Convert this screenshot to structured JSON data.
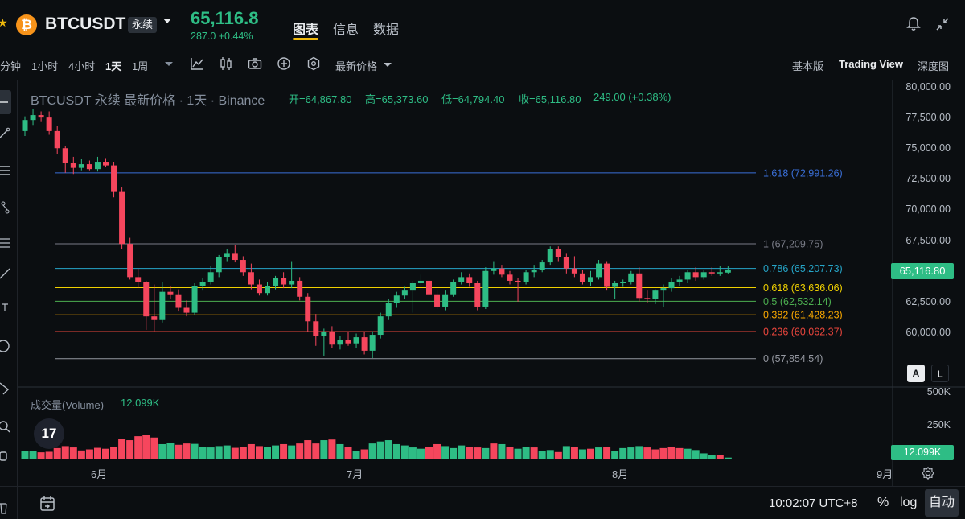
{
  "header": {
    "symbol": "BTCUSDT",
    "contract_badge": "永续",
    "last_price": "65,116.8",
    "change_text": "287.0 +0.44%",
    "tabs": [
      "图表",
      "信息",
      "数据"
    ],
    "active_tab": "图表"
  },
  "toolbar": {
    "timeframes": [
      "分钟",
      "1小时",
      "4小时",
      "1天",
      "1周"
    ],
    "active_timeframe": "1天",
    "price_type": "最新价格",
    "views": [
      "基本版",
      "Trading View",
      "深度图"
    ],
    "active_view": "Trading View"
  },
  "legend": {
    "title": "BTCUSDT 永续 最新价格 · 1天 · Binance",
    "open": "开=64,867.80",
    "high": "高=65,373.60",
    "low": "低=64,794.40",
    "close": "收=65,116.80",
    "change": "249.00 (+0.38%)"
  },
  "volume": {
    "label": "成交量(Volume)",
    "value": "12.099K",
    "axis": [
      "500K",
      "250K"
    ],
    "tag": "12.099K"
  },
  "price_axis": [
    "80,000.00",
    "77,500.00",
    "75,000.00",
    "72,500.00",
    "70,000.00",
    "67,500.00",
    "62,500.00",
    "60,000.00"
  ],
  "price_tag": "65,116.80",
  "scale_buttons": [
    "A",
    "L"
  ],
  "months": [
    "6月",
    "7月",
    "8月",
    "9月"
  ],
  "bottom": {
    "clock": "10:02:07 UTC+8",
    "percent": "%",
    "log": "log",
    "auto": "自动"
  },
  "colors": {
    "up": "#2ebd85",
    "down": "#f6465d",
    "accent": "#f0b90b",
    "background": "#0b0e11"
  },
  "chart_data": {
    "type": "candlestick",
    "interval": "1天",
    "ylim": [
      57000,
      80000
    ],
    "candles": [
      {
        "o": 76400,
        "h": 77600,
        "l": 76000,
        "c": 77300
      },
      {
        "o": 77300,
        "h": 78200,
        "l": 76900,
        "c": 77700
      },
      {
        "o": 77700,
        "h": 78000,
        "l": 77200,
        "c": 77500
      },
      {
        "o": 77500,
        "h": 78000,
        "l": 76100,
        "c": 76400
      },
      {
        "o": 76400,
        "h": 76800,
        "l": 74500,
        "c": 75000
      },
      {
        "o": 75000,
        "h": 75200,
        "l": 73000,
        "c": 73800
      },
      {
        "o": 73800,
        "h": 74300,
        "l": 72900,
        "c": 73400
      },
      {
        "o": 73400,
        "h": 74100,
        "l": 73200,
        "c": 73700
      },
      {
        "o": 73700,
        "h": 74000,
        "l": 73200,
        "c": 73300
      },
      {
        "o": 73300,
        "h": 74300,
        "l": 73100,
        "c": 73900
      },
      {
        "o": 73900,
        "h": 74200,
        "l": 73500,
        "c": 73600
      },
      {
        "o": 73600,
        "h": 73900,
        "l": 71000,
        "c": 71500
      },
      {
        "o": 71500,
        "h": 71800,
        "l": 66800,
        "c": 67200
      },
      {
        "o": 67200,
        "h": 67700,
        "l": 64300,
        "c": 64500
      },
      {
        "o": 64500,
        "h": 65200,
        "l": 63600,
        "c": 64100
      },
      {
        "o": 64100,
        "h": 64200,
        "l": 60200,
        "c": 61300
      },
      {
        "o": 61300,
        "h": 63900,
        "l": 60100,
        "c": 61000
      },
      {
        "o": 61000,
        "h": 64100,
        "l": 60800,
        "c": 63300
      },
      {
        "o": 63300,
        "h": 63800,
        "l": 62700,
        "c": 63100
      },
      {
        "o": 63100,
        "h": 63500,
        "l": 61700,
        "c": 62000
      },
      {
        "o": 62000,
        "h": 62600,
        "l": 61300,
        "c": 61600
      },
      {
        "o": 61600,
        "h": 64000,
        "l": 61400,
        "c": 63800
      },
      {
        "o": 63800,
        "h": 64400,
        "l": 63400,
        "c": 64100
      },
      {
        "o": 64100,
        "h": 65400,
        "l": 63900,
        "c": 64900
      },
      {
        "o": 64900,
        "h": 66300,
        "l": 64500,
        "c": 66100
      },
      {
        "o": 66100,
        "h": 66800,
        "l": 65800,
        "c": 66400
      },
      {
        "o": 66400,
        "h": 67100,
        "l": 65700,
        "c": 65900
      },
      {
        "o": 65900,
        "h": 66200,
        "l": 64600,
        "c": 64900
      },
      {
        "o": 64900,
        "h": 65600,
        "l": 63500,
        "c": 63900
      },
      {
        "o": 63900,
        "h": 64300,
        "l": 63000,
        "c": 63200
      },
      {
        "o": 63200,
        "h": 64100,
        "l": 63000,
        "c": 63800
      },
      {
        "o": 63800,
        "h": 64600,
        "l": 63500,
        "c": 64400
      },
      {
        "o": 64400,
        "h": 64900,
        "l": 63600,
        "c": 63900
      },
      {
        "o": 63900,
        "h": 65800,
        "l": 63600,
        "c": 64200
      },
      {
        "o": 64200,
        "h": 64500,
        "l": 62600,
        "c": 62900
      },
      {
        "o": 62900,
        "h": 63200,
        "l": 60000,
        "c": 60900
      },
      {
        "o": 60900,
        "h": 61500,
        "l": 58900,
        "c": 59700
      },
      {
        "o": 59700,
        "h": 60300,
        "l": 58100,
        "c": 60000
      },
      {
        "o": 60000,
        "h": 60500,
        "l": 58700,
        "c": 59000
      },
      {
        "o": 59000,
        "h": 59700,
        "l": 58600,
        "c": 59400
      },
      {
        "o": 59400,
        "h": 60000,
        "l": 58900,
        "c": 59100
      },
      {
        "o": 59100,
        "h": 59900,
        "l": 58700,
        "c": 59600
      },
      {
        "o": 59600,
        "h": 60000,
        "l": 58200,
        "c": 58500
      },
      {
        "o": 58500,
        "h": 60100,
        "l": 57900,
        "c": 59800
      },
      {
        "o": 59800,
        "h": 61600,
        "l": 59500,
        "c": 61300
      },
      {
        "o": 61300,
        "h": 62700,
        "l": 61000,
        "c": 62400
      },
      {
        "o": 62400,
        "h": 63300,
        "l": 62000,
        "c": 63000
      },
      {
        "o": 63000,
        "h": 63700,
        "l": 62700,
        "c": 63400
      },
      {
        "o": 63400,
        "h": 64200,
        "l": 61600,
        "c": 64000
      },
      {
        "o": 64000,
        "h": 64700,
        "l": 63700,
        "c": 64200
      },
      {
        "o": 64200,
        "h": 64500,
        "l": 62800,
        "c": 63100
      },
      {
        "o": 63100,
        "h": 63400,
        "l": 61900,
        "c": 62100
      },
      {
        "o": 62100,
        "h": 63400,
        "l": 61800,
        "c": 63100
      },
      {
        "o": 63100,
        "h": 64300,
        "l": 62900,
        "c": 64100
      },
      {
        "o": 64100,
        "h": 64900,
        "l": 63900,
        "c": 64500
      },
      {
        "o": 64500,
        "h": 64800,
        "l": 63700,
        "c": 64000
      },
      {
        "o": 64000,
        "h": 64200,
        "l": 61800,
        "c": 62100
      },
      {
        "o": 62100,
        "h": 65300,
        "l": 61900,
        "c": 65000
      },
      {
        "o": 65000,
        "h": 65800,
        "l": 64700,
        "c": 65200
      },
      {
        "o": 65200,
        "h": 65500,
        "l": 64500,
        "c": 64700
      },
      {
        "o": 64700,
        "h": 65000,
        "l": 63900,
        "c": 64200
      },
      {
        "o": 64200,
        "h": 64400,
        "l": 62500,
        "c": 64100
      },
      {
        "o": 64100,
        "h": 65100,
        "l": 63900,
        "c": 64900
      },
      {
        "o": 64900,
        "h": 65500,
        "l": 64500,
        "c": 65100
      },
      {
        "o": 65100,
        "h": 65900,
        "l": 64900,
        "c": 65700
      },
      {
        "o": 65700,
        "h": 67000,
        "l": 65500,
        "c": 66800
      },
      {
        "o": 66800,
        "h": 67000,
        "l": 65800,
        "c": 66100
      },
      {
        "o": 66100,
        "h": 66400,
        "l": 64800,
        "c": 65200
      },
      {
        "o": 65200,
        "h": 66200,
        "l": 64500,
        "c": 64800
      },
      {
        "o": 64800,
        "h": 65100,
        "l": 63900,
        "c": 64100
      },
      {
        "o": 64100,
        "h": 65000,
        "l": 63800,
        "c": 64500
      },
      {
        "o": 64500,
        "h": 65900,
        "l": 64300,
        "c": 65600
      },
      {
        "o": 65600,
        "h": 65800,
        "l": 63400,
        "c": 63700
      },
      {
        "o": 63700,
        "h": 64200,
        "l": 62700,
        "c": 64000
      },
      {
        "o": 64000,
        "h": 64300,
        "l": 63700,
        "c": 64100
      },
      {
        "o": 64100,
        "h": 65000,
        "l": 63900,
        "c": 64800
      },
      {
        "o": 64800,
        "h": 65300,
        "l": 62500,
        "c": 62800
      },
      {
        "o": 62800,
        "h": 63400,
        "l": 62400,
        "c": 62700
      },
      {
        "o": 62700,
        "h": 63500,
        "l": 62300,
        "c": 63400
      },
      {
        "o": 63400,
        "h": 63900,
        "l": 62100,
        "c": 63600
      },
      {
        "o": 63600,
        "h": 64400,
        "l": 63300,
        "c": 64100
      },
      {
        "o": 64100,
        "h": 64600,
        "l": 63800,
        "c": 64300
      },
      {
        "o": 64300,
        "h": 65100,
        "l": 64000,
        "c": 64900
      },
      {
        "o": 64900,
        "h": 65300,
        "l": 64200,
        "c": 64500
      },
      {
        "o": 64500,
        "h": 65100,
        "l": 64300,
        "c": 64900
      },
      {
        "o": 64900,
        "h": 65300,
        "l": 64600,
        "c": 64800
      },
      {
        "o": 64800,
        "h": 65400,
        "l": 64600,
        "c": 64900
      },
      {
        "o": 64867.8,
        "h": 65373.6,
        "l": 64794.4,
        "c": 65116.8
      }
    ],
    "fibonacci": [
      {
        "label": "1.618 (72,991.26)",
        "price": 72991.26,
        "color": "#3a6fd8"
      },
      {
        "label": "1 (67,209.75)",
        "price": 67209.75,
        "color": "#787b86"
      },
      {
        "label": "0.786 (65,207.73)",
        "price": 65207.73,
        "color": "#26a6c9"
      },
      {
        "label": "0.618 (63,636.06)",
        "price": 63636.06,
        "color": "#f0d000"
      },
      {
        "label": "0.5 (62,532.14)",
        "price": 62532.14,
        "color": "#4caf50"
      },
      {
        "label": "0.382 (61,428.23)",
        "price": 61428.23,
        "color": "#f7a600"
      },
      {
        "label": "0.236 (60,062.37)",
        "price": 60062.37,
        "color": "#e8453c"
      },
      {
        "label": "0 (57,854.54)",
        "price": 57854.54,
        "color": "#9598a1"
      }
    ],
    "volumes": [
      {
        "v": 55,
        "up": true
      },
      {
        "v": 60,
        "up": true
      },
      {
        "v": 48,
        "up": false
      },
      {
        "v": 52,
        "up": false
      },
      {
        "v": 80,
        "up": false
      },
      {
        "v": 95,
        "up": false
      },
      {
        "v": 85,
        "up": false
      },
      {
        "v": 62,
        "up": false
      },
      {
        "v": 70,
        "up": false
      },
      {
        "v": 82,
        "up": false
      },
      {
        "v": 75,
        "up": false
      },
      {
        "v": 90,
        "up": false
      },
      {
        "v": 150,
        "up": false
      },
      {
        "v": 140,
        "up": false
      },
      {
        "v": 170,
        "up": false
      },
      {
        "v": 180,
        "up": false
      },
      {
        "v": 160,
        "up": false
      },
      {
        "v": 110,
        "up": true
      },
      {
        "v": 120,
        "up": true
      },
      {
        "v": 105,
        "up": false
      },
      {
        "v": 115,
        "up": false
      },
      {
        "v": 112,
        "up": true
      },
      {
        "v": 90,
        "up": true
      },
      {
        "v": 85,
        "up": true
      },
      {
        "v": 95,
        "up": true
      },
      {
        "v": 100,
        "up": true
      },
      {
        "v": 82,
        "up": false
      },
      {
        "v": 90,
        "up": false
      },
      {
        "v": 110,
        "up": false
      },
      {
        "v": 95,
        "up": false
      },
      {
        "v": 90,
        "up": true
      },
      {
        "v": 100,
        "up": true
      },
      {
        "v": 110,
        "up": false
      },
      {
        "v": 100,
        "up": true
      },
      {
        "v": 115,
        "up": false
      },
      {
        "v": 140,
        "up": false
      },
      {
        "v": 115,
        "up": false
      },
      {
        "v": 140,
        "up": true
      },
      {
        "v": 145,
        "up": false
      },
      {
        "v": 110,
        "up": true
      },
      {
        "v": 90,
        "up": false
      },
      {
        "v": 60,
        "up": true
      },
      {
        "v": 70,
        "up": false
      },
      {
        "v": 115,
        "up": true
      },
      {
        "v": 130,
        "up": true
      },
      {
        "v": 140,
        "up": true
      },
      {
        "v": 110,
        "up": true
      },
      {
        "v": 100,
        "up": true
      },
      {
        "v": 85,
        "up": true
      },
      {
        "v": 75,
        "up": true
      },
      {
        "v": 90,
        "up": false
      },
      {
        "v": 110,
        "up": false
      },
      {
        "v": 95,
        "up": true
      },
      {
        "v": 80,
        "up": true
      },
      {
        "v": 100,
        "up": true
      },
      {
        "v": 90,
        "up": false
      },
      {
        "v": 85,
        "up": false
      },
      {
        "v": 80,
        "up": true
      },
      {
        "v": 115,
        "up": false
      },
      {
        "v": 110,
        "up": true
      },
      {
        "v": 90,
        "up": false
      },
      {
        "v": 75,
        "up": true
      },
      {
        "v": 90,
        "up": true
      },
      {
        "v": 85,
        "up": false
      },
      {
        "v": 60,
        "up": true
      },
      {
        "v": 65,
        "up": true
      },
      {
        "v": 50,
        "up": false
      },
      {
        "v": 95,
        "up": true
      },
      {
        "v": 90,
        "up": false
      },
      {
        "v": 70,
        "up": true
      },
      {
        "v": 75,
        "up": false
      },
      {
        "v": 85,
        "up": true
      },
      {
        "v": 90,
        "up": false
      },
      {
        "v": 55,
        "up": true
      },
      {
        "v": 80,
        "up": true
      },
      {
        "v": 85,
        "up": true
      },
      {
        "v": 95,
        "up": true
      },
      {
        "v": 85,
        "up": false
      },
      {
        "v": 70,
        "up": false
      },
      {
        "v": 80,
        "up": false
      },
      {
        "v": 90,
        "up": false
      },
      {
        "v": 80,
        "up": false
      },
      {
        "v": 75,
        "up": true
      },
      {
        "v": 65,
        "up": true
      },
      {
        "v": 40,
        "up": true
      },
      {
        "v": 30,
        "up": true
      },
      {
        "v": 25,
        "up": false
      },
      {
        "v": 8,
        "up": true
      }
    ],
    "volume_ylim": [
      0,
      600
    ]
  }
}
